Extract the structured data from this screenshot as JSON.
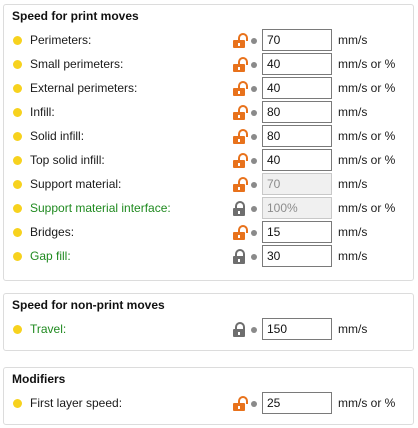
{
  "colors": {
    "dot": "#f7d21e",
    "lock_open": "#e8721c",
    "lock_closed": "#6e6e6e",
    "label_green": "#1f8a1f"
  },
  "print_moves": {
    "title": "Speed for print moves",
    "rows": [
      {
        "label": "Perimeters:",
        "lock": "lock-open-icon",
        "value": "70",
        "unit": "mm/s"
      },
      {
        "label": "Small perimeters:",
        "lock": "lock-open-icon",
        "value": "40",
        "unit": "mm/s or %"
      },
      {
        "label": "External perimeters:",
        "lock": "lock-open-icon",
        "value": "40",
        "unit": "mm/s or %"
      },
      {
        "label": "Infill:",
        "lock": "lock-open-icon",
        "value": "80",
        "unit": "mm/s"
      },
      {
        "label": "Solid infill:",
        "lock": "lock-open-icon",
        "value": "80",
        "unit": "mm/s or %"
      },
      {
        "label": "Top solid infill:",
        "lock": "lock-open-icon",
        "value": "40",
        "unit": "mm/s or %"
      },
      {
        "label": "Support material:",
        "lock": "lock-open-icon",
        "value": "70",
        "unit": "mm/s",
        "disabled": true
      },
      {
        "label": "Support material interface:",
        "lock": "lock-closed-icon",
        "value": "100%",
        "unit": "mm/s or %",
        "disabled": true,
        "green": true
      },
      {
        "label": "Bridges:",
        "lock": "lock-open-icon",
        "value": "15",
        "unit": "mm/s"
      },
      {
        "label": "Gap fill:",
        "lock": "lock-closed-icon",
        "value": "30",
        "unit": "mm/s",
        "green": true
      }
    ]
  },
  "non_print_moves": {
    "title": "Speed for non-print moves",
    "rows": [
      {
        "label": "Travel:",
        "lock": "lock-closed-icon",
        "value": "150",
        "unit": "mm/s",
        "green": true
      }
    ]
  },
  "modifiers": {
    "title": "Modifiers",
    "rows": [
      {
        "label": "First layer speed:",
        "lock": "lock-open-icon",
        "value": "25",
        "unit": "mm/s or %"
      }
    ]
  }
}
